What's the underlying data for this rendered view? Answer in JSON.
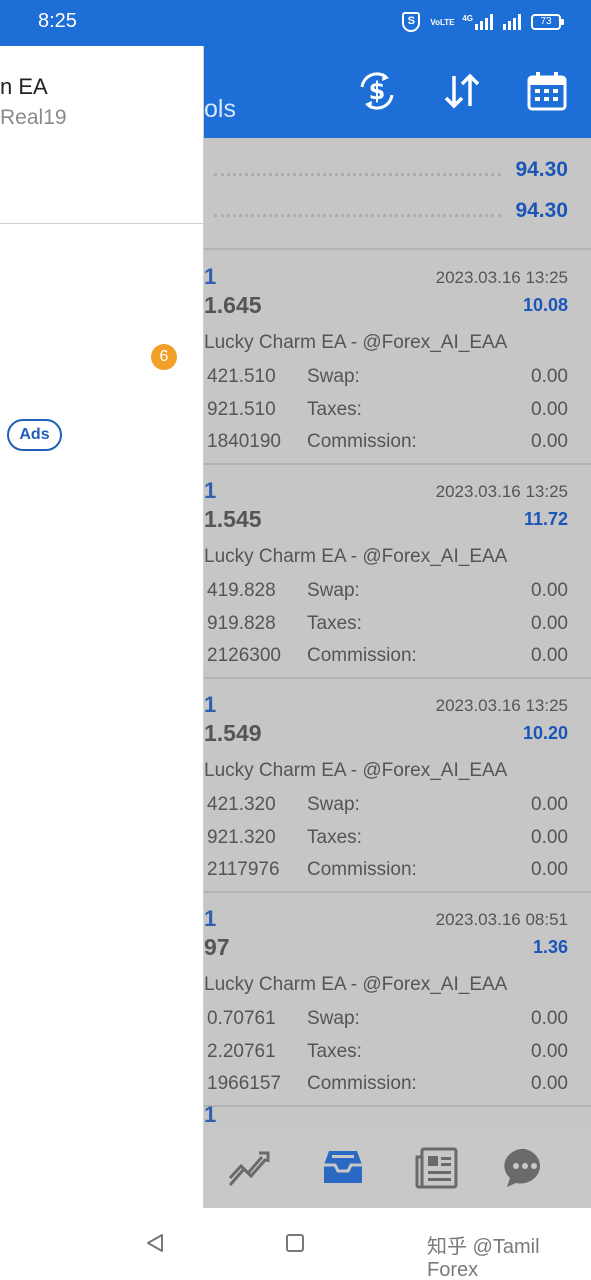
{
  "status_bar": {
    "time": "8:25",
    "volte": "VoLTE",
    "network": "4G",
    "battery": "73"
  },
  "header": {
    "title_fragment": "ols",
    "icons": [
      "currency-exchange-icon",
      "sort-icon",
      "calendar-icon"
    ]
  },
  "summary": {
    "rows": [
      {
        "value": "94.30"
      },
      {
        "value": "94.30"
      }
    ]
  },
  "deals": [
    {
      "symbol_fragment": "1",
      "price_fragment": "1.645",
      "date": "2023.03.16 13:25",
      "profit": "10.08",
      "comment": "Lucky Charm EA - @Forex_AI_EAA",
      "lines": [
        {
          "value": "421.510",
          "label": "Swap:",
          "amount": "0.00"
        },
        {
          "value": "921.510",
          "label": "Taxes:",
          "amount": "0.00"
        },
        {
          "value": "1840190",
          "label": "Commission:",
          "amount": "0.00"
        }
      ]
    },
    {
      "symbol_fragment": "1",
      "price_fragment": "1.545",
      "date": "2023.03.16 13:25",
      "profit": "11.72",
      "comment": "Lucky Charm EA - @Forex_AI_EAA",
      "lines": [
        {
          "value": "419.828",
          "label": "Swap:",
          "amount": "0.00"
        },
        {
          "value": "919.828",
          "label": "Taxes:",
          "amount": "0.00"
        },
        {
          "value": "2126300",
          "label": "Commission:",
          "amount": "0.00"
        }
      ]
    },
    {
      "symbol_fragment": "1",
      "price_fragment": "1.549",
      "date": "2023.03.16 13:25",
      "profit": "10.20",
      "comment": "Lucky Charm EA - @Forex_AI_EAA",
      "lines": [
        {
          "value": "421.320",
          "label": "Swap:",
          "amount": "0.00"
        },
        {
          "value": "921.320",
          "label": "Taxes:",
          "amount": "0.00"
        },
        {
          "value": "2117976",
          "label": "Commission:",
          "amount": "0.00"
        }
      ]
    },
    {
      "symbol_fragment": "1",
      "price_fragment": "97",
      "date": "2023.03.16 08:51",
      "profit": "1.36",
      "comment": "Lucky Charm EA - @Forex_AI_EAA",
      "lines": [
        {
          "value": "0.70761",
          "label": "Swap:",
          "amount": "0.00"
        },
        {
          "value": "2.20761",
          "label": "Taxes:",
          "amount": "0.00"
        },
        {
          "value": "1966157",
          "label": "Commission:",
          "amount": "0.00"
        }
      ]
    }
  ],
  "partial_deal": {
    "symbol_fragment": "1"
  },
  "bottom_tabs": [
    {
      "icon": "chart-icon"
    },
    {
      "icon": "history-inbox-icon",
      "active": true
    },
    {
      "icon": "news-icon"
    },
    {
      "icon": "chat-icon"
    }
  ],
  "drawer": {
    "name_fragment": "n EA",
    "account_fragment": "Real19",
    "badge": "6",
    "ads_label": "Ads"
  },
  "watermark": "知乎 @Tamil Forex",
  "colors": {
    "primary": "#1d6ed6",
    "accent_blue": "#1a56b8",
    "badge_orange": "#f2a02a",
    "dim_gray": "#c6c6c6"
  }
}
